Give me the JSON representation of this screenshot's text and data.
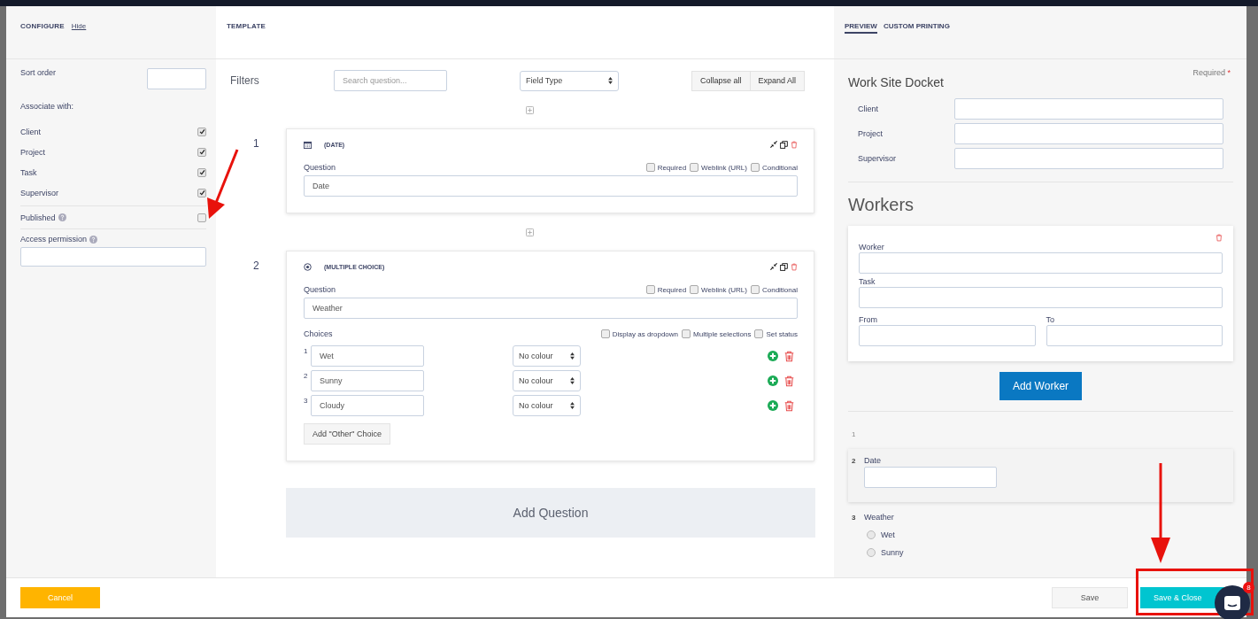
{
  "configure": {
    "title": "CONFIGURE",
    "hide_link": "Hide",
    "sort_order_label": "Sort order",
    "associate_label": "Associate with:",
    "associations": [
      {
        "label": "Client",
        "checked": true
      },
      {
        "label": "Project",
        "checked": true
      },
      {
        "label": "Task",
        "checked": true
      },
      {
        "label": "Supervisor",
        "checked": true
      }
    ],
    "published": {
      "label": "Published",
      "checked": false
    },
    "access_permission": {
      "label": "Access permission"
    }
  },
  "template": {
    "title": "TEMPLATE",
    "filters_label": "Filters",
    "search": {
      "placeholder": "Search question..."
    },
    "field_type": "Field Type",
    "buttons": [
      "Collapse all",
      "Expand All"
    ],
    "questions": [
      {
        "number": "1",
        "kind": "date",
        "type_label": "(DATE)",
        "question_label": "Question",
        "value": "Date",
        "options": [
          {
            "label": "Required",
            "checked": false
          },
          {
            "label": "Weblink (URL)",
            "checked": false
          },
          {
            "label": "Conditional",
            "checked": false
          }
        ]
      },
      {
        "number": "2",
        "kind": "multiple_choice",
        "type_label": "(MULTIPLE CHOICE)",
        "question_label": "Question",
        "value": "Weather",
        "options": [
          {
            "label": "Required",
            "checked": false
          },
          {
            "label": "Weblink (URL)",
            "checked": false
          },
          {
            "label": "Conditional",
            "checked": false
          }
        ],
        "choices_label": "Choices",
        "choice_options": [
          {
            "label": "Display as dropdown",
            "checked": false
          },
          {
            "label": "Multiple selections",
            "checked": false
          },
          {
            "label": "Set status",
            "checked": false
          }
        ],
        "choices": [
          {
            "number": "1",
            "value": "Wet",
            "colour": "No colour"
          },
          {
            "number": "2",
            "value": "Sunny",
            "colour": "No colour"
          },
          {
            "number": "3",
            "value": "Cloudy",
            "colour": "No colour"
          }
        ],
        "other_button": "Add \"Other\" Choice"
      }
    ],
    "add_question": "Add Question"
  },
  "preview": {
    "tabs": [
      {
        "label": "PREVIEW",
        "selected": true
      },
      {
        "label": "CUSTOM PRINTING",
        "selected": false
      }
    ],
    "required_note": "Required",
    "required_mark": "*",
    "title": "Work Site Docket",
    "fields": [
      "Client",
      "Project",
      "Supervisor"
    ],
    "workers_title": "Workers",
    "worker_fields": [
      "Worker",
      "Task"
    ],
    "worker_pair": [
      "From",
      "To"
    ],
    "add_worker": "Add Worker",
    "items": [
      {
        "number": "1",
        "kind": "empty"
      },
      {
        "number": "2",
        "kind": "text",
        "label": "Date"
      },
      {
        "number": "3",
        "kind": "radio",
        "label": "Weather",
        "options": [
          {
            "label": "Wet",
            "selected": false
          },
          {
            "label": "Sunny",
            "selected": false
          }
        ]
      }
    ]
  },
  "footer": {
    "cancel": "Cancel",
    "save": "Save",
    "save_close": "Save & Close"
  },
  "chat": {
    "badge": "8"
  }
}
